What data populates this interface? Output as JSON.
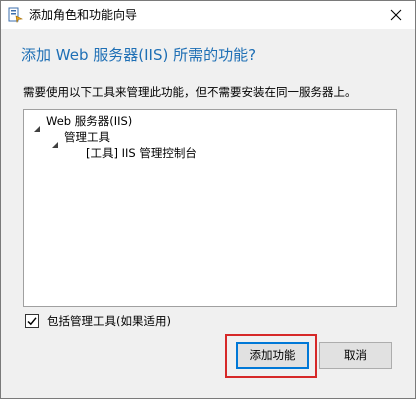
{
  "window": {
    "title": "添加角色和功能向导",
    "app_icon": "server-wizard-icon",
    "close_icon": "close-icon"
  },
  "heading": "添加 Web 服务器(IIS) 所需的功能?",
  "description": "需要使用以下工具来管理此功能，但不需要安装在同一服务器上。",
  "tree": {
    "items": [
      {
        "label": "Web 服务器(IIS)",
        "expanded": true,
        "level": 0
      },
      {
        "label": "管理工具",
        "expanded": true,
        "level": 1
      },
      {
        "label": "[工具] IIS 管理控制台",
        "expanded": false,
        "level": 2
      }
    ]
  },
  "include_tools": {
    "label": "包括管理工具(如果适用)",
    "checked": true
  },
  "buttons": {
    "add": "添加功能",
    "cancel": "取消"
  },
  "colors": {
    "heading": "#1e6fb5",
    "highlight": "#d62828",
    "focus_border": "#0078d7"
  }
}
